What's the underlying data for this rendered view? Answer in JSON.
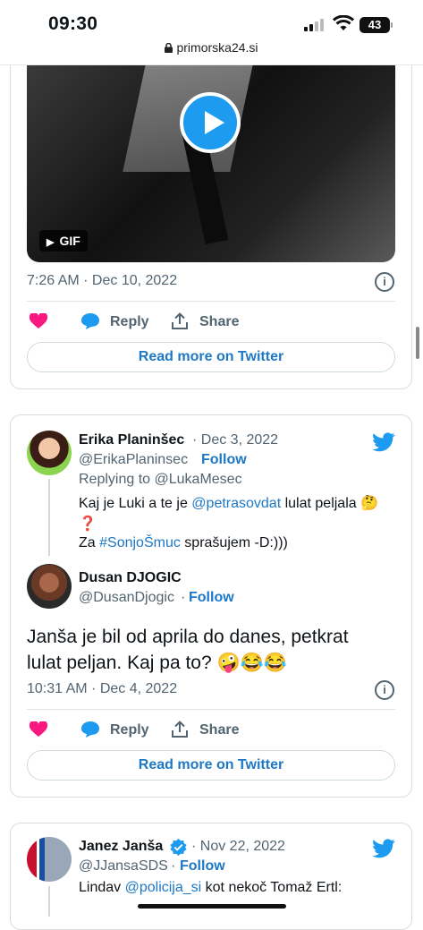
{
  "status_bar": {
    "time": "09:30",
    "battery": "43",
    "url": "primorska24.si"
  },
  "tweet1": {
    "media_badge": "GIF",
    "timestamp": "7:26 AM · Dec 10, 2022",
    "reply_label": "Reply",
    "share_label": "Share",
    "read_more": "Read more on Twitter"
  },
  "tweet2": {
    "author": {
      "name": "Erika Planinšec",
      "date": "· Dec 3, 2022",
      "handle": "@ErikaPlaninsec",
      "follow": "Follow"
    },
    "replying_prefix": "Replying to ",
    "replying_to": "@LukaMesec",
    "text_line1_a": "Kaj je Luki a te je ",
    "text_line1_link": "@petrasovdat",
    "text_line1_b": " lulat peljala 🤔",
    "text_line2": "❓",
    "text_line3_a": "Za ",
    "text_line3_link": "#SonjoŠmuc",
    "text_line3_b": " sprašujem -D:)))",
    "reply_author": {
      "name": "Dusan DJOGIC",
      "handle": "@DusanDjogic",
      "dot": "·",
      "follow": "Follow"
    },
    "main_text_line1": "Janša je bil od aprila do danes, petkrat",
    "main_text_line2": "lulat peljan. Kaj pa to? 🤪😂😂",
    "timestamp": "10:31 AM · Dec 4, 2022",
    "reply_label": "Reply",
    "share_label": "Share",
    "read_more": "Read more on Twitter"
  },
  "tweet3": {
    "author": {
      "name": "Janez Janša",
      "date": "· Nov 22, 2022",
      "handle": "@JJansaSDS",
      "dot": "·",
      "follow": "Follow"
    },
    "text_a": "Lindav ",
    "text_link": "@policija_si",
    "text_b": " kot nekoč Tomaž Ertl:"
  },
  "colors": {
    "twitter_blue": "#1d9bf0",
    "link_blue": "#1d78c6",
    "like_pink": "#f91880",
    "muted": "#536471"
  },
  "icons": [
    "lock-icon",
    "signal-icon",
    "wifi-icon",
    "battery-icon",
    "play-icon",
    "info-icon",
    "heart-icon",
    "reply-bubble-icon",
    "share-icon",
    "twitter-bird-icon",
    "verified-badge-icon"
  ]
}
